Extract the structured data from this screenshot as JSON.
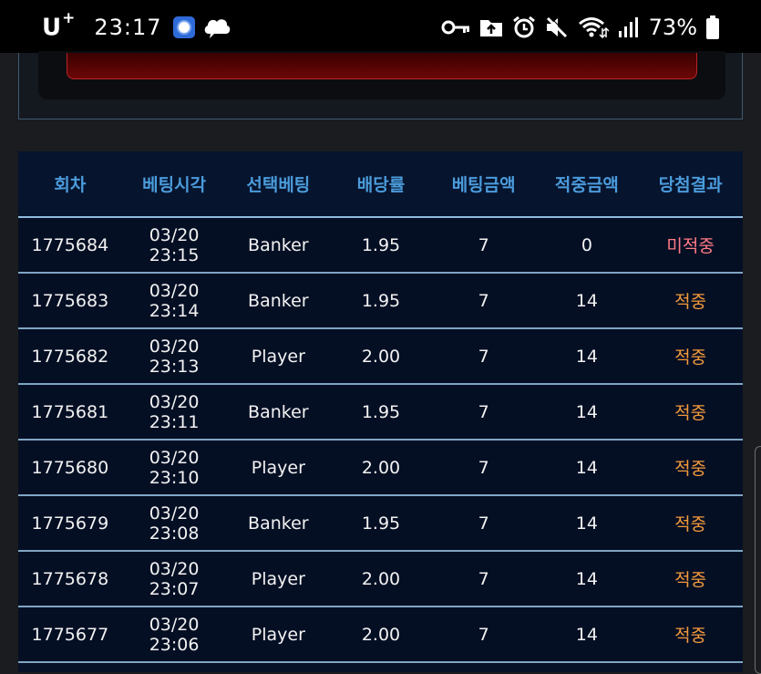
{
  "status_bar": {
    "carrier": "U",
    "carrier_sup": "+",
    "time": "23:17",
    "battery_percent": "73%",
    "icons_left": [
      "app-badge-icon",
      "cloud-chat-icon"
    ],
    "icons_right": [
      "key-icon",
      "folder-upload-icon",
      "alarm-icon",
      "mute-icon",
      "wifi-icon",
      "signal-icon",
      "battery-icon"
    ]
  },
  "table": {
    "headers": [
      "회차",
      "베팅시각",
      "선택베팅",
      "배당률",
      "베팅금액",
      "적중금액",
      "당첨결과"
    ],
    "rows": [
      {
        "round": "1775684",
        "time": "03/20 23:15",
        "pick": "Banker",
        "odds": "1.95",
        "bet": "7",
        "win": "0",
        "result": "미적중",
        "status": "miss"
      },
      {
        "round": "1775683",
        "time": "03/20 23:14",
        "pick": "Banker",
        "odds": "1.95",
        "bet": "7",
        "win": "14",
        "result": "적중",
        "status": "hit"
      },
      {
        "round": "1775682",
        "time": "03/20 23:13",
        "pick": "Player",
        "odds": "2.00",
        "bet": "7",
        "win": "14",
        "result": "적중",
        "status": "hit"
      },
      {
        "round": "1775681",
        "time": "03/20 23:11",
        "pick": "Banker",
        "odds": "1.95",
        "bet": "7",
        "win": "14",
        "result": "적중",
        "status": "hit"
      },
      {
        "round": "1775680",
        "time": "03/20 23:10",
        "pick": "Player",
        "odds": "2.00",
        "bet": "7",
        "win": "14",
        "result": "적중",
        "status": "hit"
      },
      {
        "round": "1775679",
        "time": "03/20 23:08",
        "pick": "Banker",
        "odds": "1.95",
        "bet": "7",
        "win": "14",
        "result": "적중",
        "status": "hit"
      },
      {
        "round": "1775678",
        "time": "03/20 23:07",
        "pick": "Player",
        "odds": "2.00",
        "bet": "7",
        "win": "14",
        "result": "적중",
        "status": "hit"
      },
      {
        "round": "1775677",
        "time": "03/20 23:06",
        "pick": "Player",
        "odds": "2.00",
        "bet": "7",
        "win": "14",
        "result": "적중",
        "status": "hit"
      }
    ]
  },
  "colors": {
    "header_text": "#4b9bdb",
    "miss": "#ff7b86",
    "hit": "#f29a3c",
    "row_border": "#7fa5c4"
  }
}
